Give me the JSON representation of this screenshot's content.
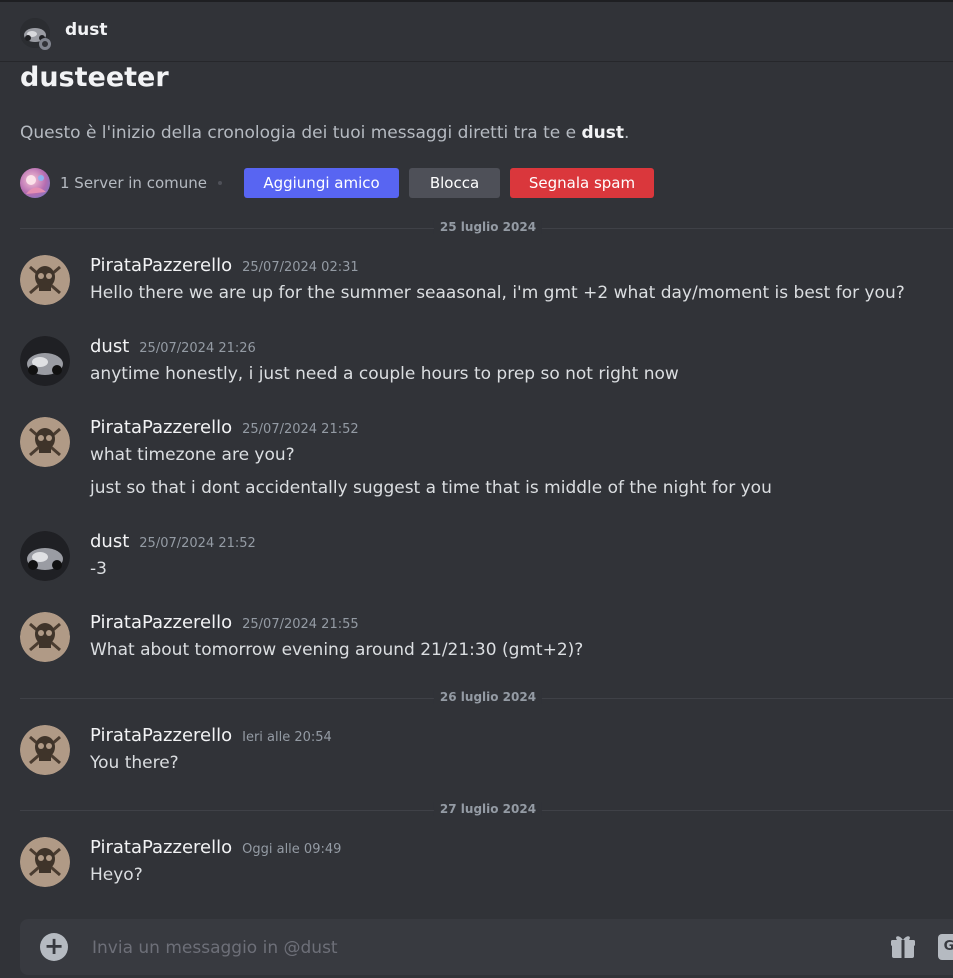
{
  "header": {
    "name": "dust"
  },
  "intro": {
    "title": "dusteeter",
    "text_prefix": "Questo è l'inizio della cronologia dei tuoi messaggi diretti tra te e ",
    "text_name": "dust",
    "text_suffix": ".",
    "server_text": "1 Server in comune",
    "buttons": {
      "add_friend": "Aggiungi amico",
      "block": "Blocca",
      "report_spam": "Segnala spam"
    }
  },
  "dividers": [
    "25 luglio 2024",
    "26 luglio 2024",
    "27 luglio 2024"
  ],
  "messages": [
    {
      "author": "PirataPazzerello",
      "time": "25/07/2024 02:31",
      "lines": [
        "Hello there we are up for the summer seaasonal, i'm gmt +2 what day/moment is best for you?"
      ]
    },
    {
      "author": "dust",
      "time": "25/07/2024 21:26",
      "lines": [
        "anytime honestly, i just need a couple hours to prep so not right now"
      ]
    },
    {
      "author": "PirataPazzerello",
      "time": "25/07/2024 21:52",
      "lines": [
        "what timezone are you?",
        "just so that i dont accidentally suggest  a time that is middle of the night for you"
      ]
    },
    {
      "author": "dust",
      "time": "25/07/2024 21:52",
      "lines": [
        "-3"
      ]
    },
    {
      "author": "PirataPazzerello",
      "time": "25/07/2024 21:55",
      "lines": [
        "What about tomorrow evening around 21/21:30 (gmt+2)?"
      ]
    },
    {
      "author": "PirataPazzerello",
      "time": "Ieri alle 20:54",
      "lines": [
        "You there?"
      ]
    },
    {
      "author": "PirataPazzerello",
      "time": "Oggi alle 09:49",
      "lines": [
        "Heyo?"
      ]
    }
  ],
  "composer": {
    "placeholder": "Invia un messaggio in @dust",
    "gif_label": "G"
  },
  "colors": {
    "background": "#313338",
    "blurple": "#5865f2",
    "danger": "#da373c",
    "secondary": "#4e5058"
  }
}
